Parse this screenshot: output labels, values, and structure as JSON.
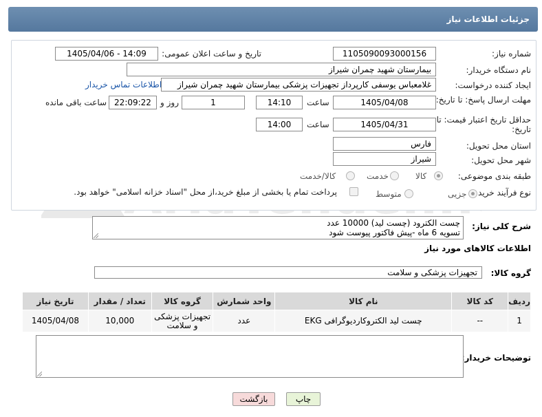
{
  "header": {
    "title": "جزئیات اطلاعات نیاز"
  },
  "form": {
    "need_number_label": "شماره نیاز:",
    "need_number": "1105090093000156",
    "announce_label": "تاریخ و ساعت اعلان عمومی:",
    "announce_value": "1405/04/06 - 14:09",
    "buyer_org_label": "نام دستگاه خریدار:",
    "buyer_org": "بیمارستان شهید چمران شیراز",
    "creator_label": "ایجاد کننده درخواست:",
    "creator": "غلامعباس  یوسفی کارپرداز تجهیزات پزشکی بیمارستان شهید چمران شیراز",
    "contact_link": "اطلاعات تماس خریدار",
    "reply_deadline_label": "مهلت ارسال پاسخ: تا تاریخ:",
    "reply_date": "1405/04/08",
    "time_label": "ساعت",
    "reply_time": "14:10",
    "days_value": "1",
    "days_label": "روز و",
    "remaining_time": "22:09:22",
    "remaining_label": "ساعت باقی مانده",
    "price_deadline_label": "حداقل تاريخ اعتبار قيمت: تا تاریخ:",
    "price_date": "1405/04/31",
    "price_time": "14:00",
    "province_label": "استان محل تحویل:",
    "province": "فارس",
    "city_label": "شهر محل تحویل:",
    "city": "شیراز",
    "category_label": "طبقه بندی موضوعی:",
    "category_options": [
      "کالا",
      "خدمت",
      "کالا/خدمت"
    ],
    "process_label": "نوع فرآیند خرید :",
    "process_options": [
      "جزیی",
      "متوسط"
    ],
    "payment_note": "پرداخت تمام یا بخشی از مبلغ خرید،از محل \"اسناد خزانه اسلامی\" خواهد بود."
  },
  "description": {
    "label": "شرح کلی نیاز:",
    "line1": "چست الکترود (چست لید) 10000 عدد",
    "line2": "تسویه 6 ماه -پیش فاکتور پیوست شود"
  },
  "goods": {
    "section_title": "اطلاعات کالاهای مورد نیاز",
    "group_label": "گروه کالا:",
    "group_value": "تجهیزات پزشکی و سلامت",
    "columns": [
      "ردیف",
      "کد کالا",
      "نام کالا",
      "واحد شمارش",
      "گروه کالا",
      "تعداد / مقدار",
      "تاریخ نیاز"
    ],
    "rows": [
      {
        "row": "1",
        "code": "--",
        "name": "چست لید الکتروکاردیوگرافی EKG",
        "unit": "عدد",
        "group": "تجهیزات پزشکی و سلامت",
        "qty": "10,000",
        "date": "1405/04/08"
      }
    ]
  },
  "buyer_notes": {
    "label": "توضیحات خریدار:",
    "value": ""
  },
  "buttons": {
    "print": "چاپ",
    "back": "بازگشت"
  },
  "colors": {
    "header": "#5f82a8",
    "link": "#1a55a8",
    "back_button": "#f7dada",
    "print_button": "#e8f4d8"
  }
}
